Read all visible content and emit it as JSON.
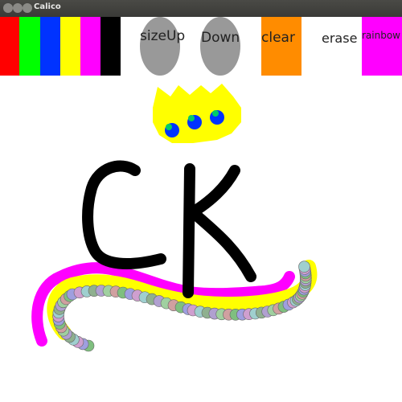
{
  "window": {
    "title": "Calico"
  },
  "toolbar": {
    "colors": [
      {
        "name": "red",
        "hex": "#ff0000"
      },
      {
        "name": "green",
        "hex": "#00ff00"
      },
      {
        "name": "blue",
        "hex": "#0033ff"
      },
      {
        "name": "yellow",
        "hex": "#ffff00"
      },
      {
        "name": "magenta",
        "hex": "#ff00ff"
      },
      {
        "name": "black",
        "hex": "#000000"
      }
    ],
    "size_up_label": "sizeUp",
    "size_down_label": "Down",
    "clear_label": "clear",
    "erase_label": "erase",
    "rainbow_label": "rainbow",
    "button_gray": "#999999",
    "clear_color": "#ff8c00",
    "rainbow_color": "#ff00ff"
  },
  "canvas": {
    "background": "#ffffff",
    "drawing_description_colors": [
      "#ffff00",
      "#ff00ff",
      "#000000",
      "#0033ff",
      "#00cc66"
    ]
  }
}
